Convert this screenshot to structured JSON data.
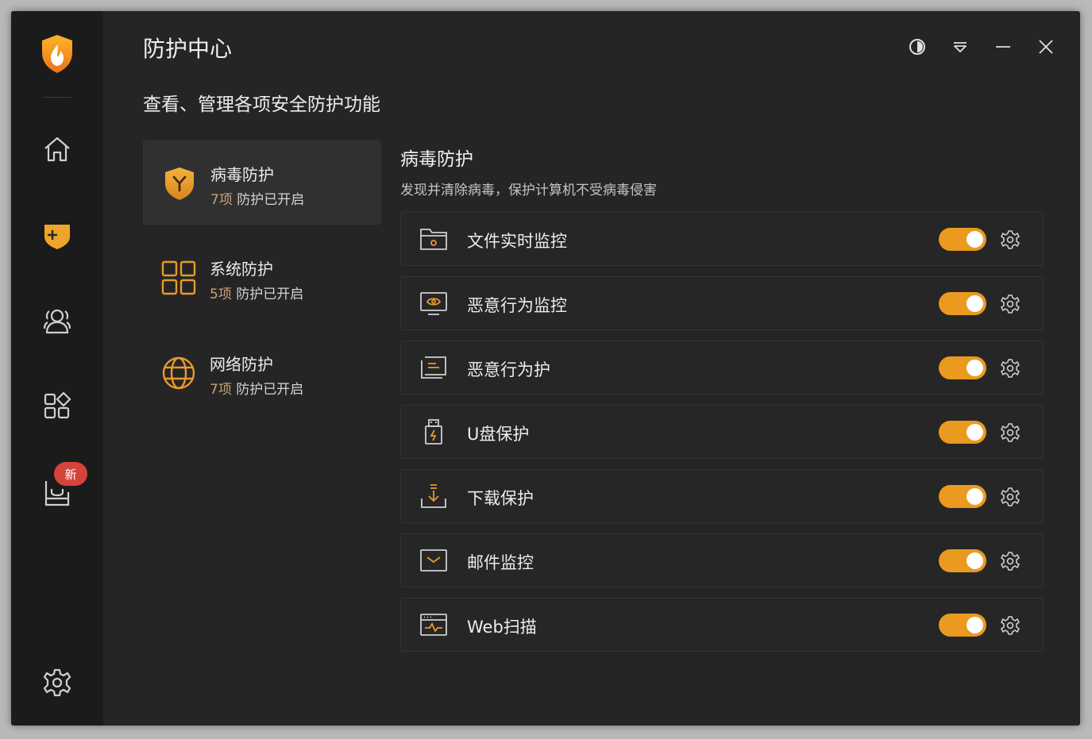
{
  "window": {
    "title": "防护中心",
    "subtitle": "查看、管理各项安全防护功能"
  },
  "sidebar": {
    "items": [
      {
        "name": "home",
        "icon": "home-icon"
      },
      {
        "name": "protection",
        "icon": "shield-plus-icon",
        "active": true
      },
      {
        "name": "users",
        "icon": "users-icon"
      },
      {
        "name": "apps",
        "icon": "apps-icon"
      },
      {
        "name": "toolbox",
        "icon": "box-icon",
        "badge": "新"
      },
      {
        "name": "settings",
        "icon": "gear-icon"
      }
    ]
  },
  "categories": [
    {
      "name": "病毒防护",
      "count": "7项",
      "status": "防护已开启",
      "icon": "virus-shield-icon",
      "active": true
    },
    {
      "name": "系统防护",
      "count": "5项",
      "status": "防护已开启",
      "icon": "grid-icon"
    },
    {
      "name": "网络防护",
      "count": "7项",
      "status": "防护已开启",
      "icon": "globe-icon"
    }
  ],
  "detail": {
    "title": "病毒防护",
    "description": "发现并清除病毒，保护计算机不受病毒侵害",
    "features": [
      {
        "label": "文件实时监控",
        "icon": "folder-monitor-icon",
        "enabled": true
      },
      {
        "label": "恶意行为监控",
        "icon": "screen-eye-icon",
        "enabled": true
      },
      {
        "label": "恶意行为护",
        "icon": "terminal-icon",
        "enabled": true
      },
      {
        "label": "U盘保护",
        "icon": "usb-icon",
        "enabled": true
      },
      {
        "label": "下载保护",
        "icon": "download-icon",
        "enabled": true
      },
      {
        "label": "邮件监控",
        "icon": "mail-icon",
        "enabled": true
      },
      {
        "label": "Web扫描",
        "icon": "web-scan-icon",
        "enabled": true
      }
    ]
  },
  "colors": {
    "accent": "#ea9a1e",
    "background": "#252525",
    "sidebar": "#1b1b1b"
  }
}
